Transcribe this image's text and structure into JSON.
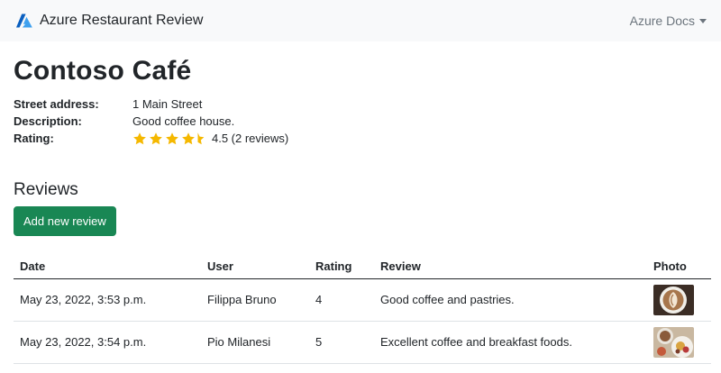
{
  "navbar": {
    "brand": "Azure Restaurant Review",
    "brand_icon": "azure-logo",
    "menu_label": "Azure Docs",
    "colors": {
      "background": "#f8f9fa",
      "logo": "#0078d4"
    }
  },
  "restaurant": {
    "name": "Contoso Café",
    "fields": {
      "address_label": "Street address:",
      "address": "1 Main Street",
      "description_label": "Description:",
      "description": "Good coffee house.",
      "rating_label": "Rating:"
    },
    "rating": {
      "stars": 4.5,
      "max_stars": 5,
      "text": "4.5 (2 reviews)",
      "star_color": "#f5b800"
    }
  },
  "reviews": {
    "title": "Reviews",
    "add_button": "Add new review",
    "button_color": "#198754",
    "columns": [
      "Date",
      "User",
      "Rating",
      "Review",
      "Photo"
    ],
    "rows": [
      {
        "date": "May 23, 2022, 3:53 p.m.",
        "user": "Filippa Bruno",
        "rating": "4",
        "review": "Good coffee and pastries.",
        "photo": "latte-art-photo"
      },
      {
        "date": "May 23, 2022, 3:54 p.m.",
        "user": "Pio Milanesi",
        "rating": "5",
        "review": "Excellent coffee and breakfast foods.",
        "photo": "breakfast-photo"
      }
    ]
  }
}
